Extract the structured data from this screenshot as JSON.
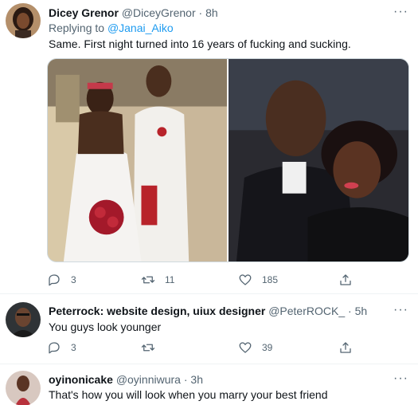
{
  "tweets": [
    {
      "display_name": "Dicey Grenor",
      "handle": "@DiceyGrenor",
      "dot": "·",
      "time": "8h",
      "replying_prefix": "Replying to",
      "replying_to": "@Janai_Aiko",
      "text": "Same. First night turned into 16 years of fucking and sucking.",
      "more": "···",
      "reply_count": "3",
      "retweet_count": "11",
      "like_count": "185",
      "share_count": "",
      "media": [
        "wedding-photo",
        "couple-photo"
      ]
    },
    {
      "display_name": "Peterrock: website design, uiux designer",
      "handle": "@PeterROCK_",
      "dot": "·",
      "time": "5h",
      "text": "You guys look younger",
      "more": "···",
      "reply_count": "3",
      "retweet_count": "",
      "like_count": "39",
      "share_count": ""
    },
    {
      "display_name": "oyinonicake",
      "handle": "@oyinniwura",
      "dot": "·",
      "time": "3h",
      "text": "That's how you will look when you marry your best friend",
      "more": "···"
    }
  ],
  "colors": {
    "text": "#0f1419",
    "secondary": "#536471",
    "link": "#1d9bf0",
    "divider": "#eff3f4"
  },
  "icons": [
    "reply-icon",
    "retweet-icon",
    "like-icon",
    "share-icon",
    "more-icon"
  ]
}
